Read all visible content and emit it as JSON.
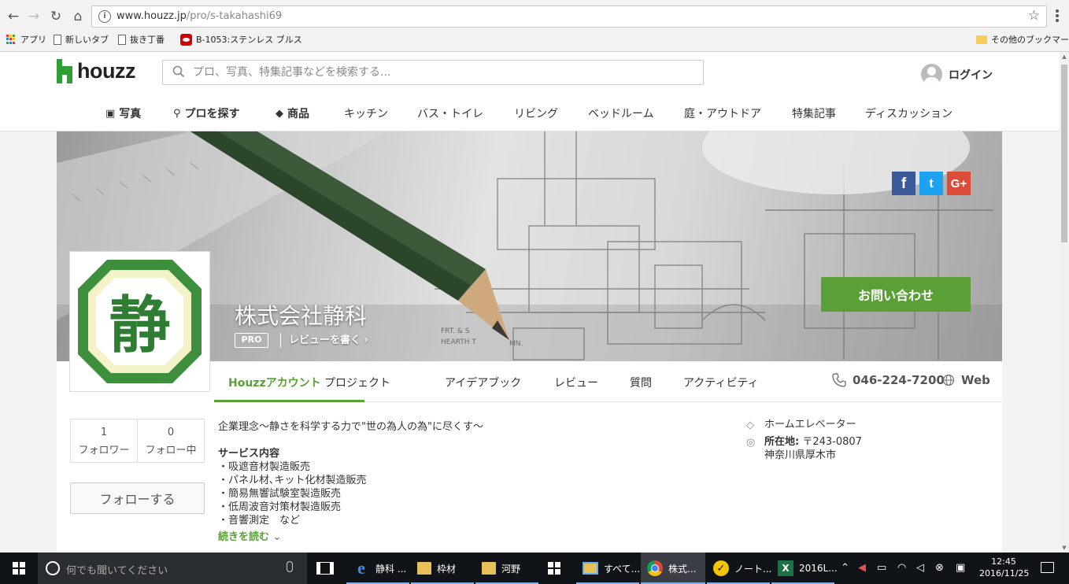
{
  "browser": {
    "url_host": "www.houzz.jp",
    "url_path": "/pro/s-takahashi69",
    "bookmarks": [
      "アプリ",
      "新しいタブ",
      "抜き丁番",
      "B-1053:ステンレス ブルス",
      "その他のブックマーク"
    ]
  },
  "site": {
    "logo_text": "houzz",
    "search_placeholder": "プロ、写真、特集記事などを検索する...",
    "login_label": "ログイン",
    "brand_color": "#5aa037",
    "nav": [
      {
        "label": "写真",
        "icon": "photo-icon"
      },
      {
        "label": "プロを探す",
        "icon": "person-icon"
      },
      {
        "label": "商品",
        "icon": "tag-icon"
      },
      {
        "label": "キッチン"
      },
      {
        "label": "バス・トイレ"
      },
      {
        "label": "リビング"
      },
      {
        "label": "ベッドルーム"
      },
      {
        "label": "庭・アウトドア"
      },
      {
        "label": "特集記事"
      },
      {
        "label": "ディスカッション"
      }
    ]
  },
  "profile": {
    "company_name": "株式会社静科",
    "pro_badge": "PRO",
    "write_review": "レビューを書く ›",
    "contact_button": "お問い合わせ",
    "logo_char": "静",
    "social": {
      "facebook": "f",
      "twitter": "t",
      "google_plus": "G+"
    },
    "tabs": [
      "Houzzアカウント",
      "プロジェクト",
      "アイデアブック",
      "レビュー",
      "質問",
      "アクティビティ"
    ],
    "phone": "046-224-7200",
    "web": "Web",
    "stats": [
      {
        "count": "1",
        "label": "フォロワー"
      },
      {
        "count": "0",
        "label": "フォロー中"
      }
    ],
    "follow_button": "フォローする",
    "philosophy": "企業理念～静さを科学する力で\"世の為人の為\"に尽くす～",
    "services_title": "サービス内容",
    "services": [
      "・吸遮音材製造販売",
      "・パネル材､キット化材製造販売",
      "・簡易無響試験室製造販売",
      "・低周波音対策材製造販売",
      "・音響測定　など"
    ],
    "read_more": "続きを読む ⌄",
    "category": "ホームエレベーター",
    "location_label": "所在地:",
    "postal": "〒243-0807",
    "address": "神奈川県厚木市"
  },
  "taskbar": {
    "search_placeholder": "何でも聞いてください",
    "apps": [
      {
        "label": "静科 ...",
        "icon": "edge-icon"
      },
      {
        "label": "枠材",
        "icon": "folder-icon"
      },
      {
        "label": "河野",
        "icon": "folder-icon"
      },
      {
        "label": "",
        "icon": "store-icon"
      },
      {
        "label": "すべて...",
        "icon": "photos-icon"
      },
      {
        "label": "株式...",
        "icon": "chrome-icon"
      },
      {
        "label": "ノート...",
        "icon": "norton-icon"
      },
      {
        "label": "2016L...",
        "icon": "excel-icon"
      }
    ],
    "time": "12:45",
    "date": "2016/11/25"
  }
}
